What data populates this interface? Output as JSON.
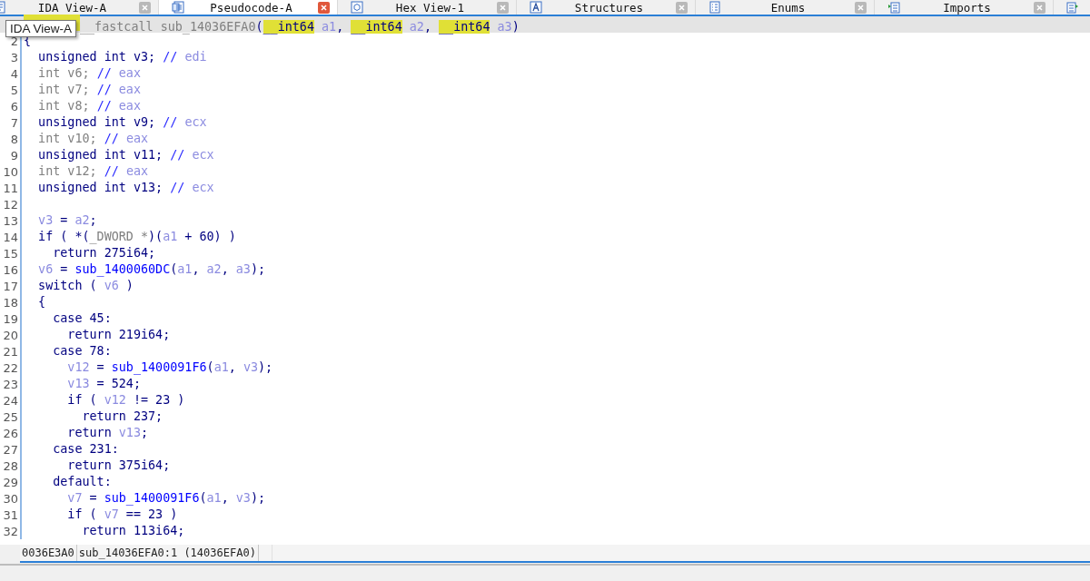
{
  "tabs": [
    {
      "label": "IDA View-A",
      "selected": false,
      "kind": "disasm"
    },
    {
      "label": "Pseudocode-A",
      "selected": true,
      "kind": "pseudocode"
    },
    {
      "label": "Hex View-1",
      "selected": false,
      "kind": "hex"
    },
    {
      "label": "Structures",
      "selected": false,
      "kind": "struct"
    },
    {
      "label": "Enums",
      "selected": false,
      "kind": "enum"
    },
    {
      "label": "Imports",
      "selected": false,
      "kind": "imports"
    },
    {
      "selected": false,
      "kind": "exports"
    }
  ],
  "tooltip": "IDA View-A",
  "code": {
    "lines": [
      {
        "tokens": [
          {
            "kind": "hl"
          },
          {
            "kind": "dim",
            "text": "__fastcall sub_14036EFA0"
          },
          {
            "kind": "plain",
            "text": "("
          },
          {
            "kind": "hl",
            "text": "__int64"
          },
          {
            "kind": "var",
            "text": " a1"
          },
          {
            "kind": "plain",
            "text": ", "
          },
          {
            "kind": "hl",
            "text": "__int64"
          },
          {
            "kind": "var",
            "text": " a2"
          },
          {
            "kind": "plain",
            "text": ", "
          },
          {
            "kind": "hl",
            "text": "__int64"
          },
          {
            "kind": "var",
            "text": " a3"
          },
          {
            "kind": "plain",
            "text": ")"
          }
        ]
      },
      {
        "number": "2",
        "tokens": [
          {
            "kind": "plain",
            "text": "{"
          }
        ]
      },
      {
        "number": "3",
        "tokens": [
          {
            "kind": "plain",
            "text": "  unsigned int v3; "
          },
          {
            "kind": "comment",
            "text": "// "
          },
          {
            "kind": "var",
            "text": "edi"
          }
        ]
      },
      {
        "number": "4",
        "tokens": [
          {
            "kind": "dim",
            "text": "  int v6; "
          },
          {
            "kind": "comment",
            "text": "// "
          },
          {
            "kind": "var",
            "text": "eax"
          }
        ]
      },
      {
        "number": "5",
        "tokens": [
          {
            "kind": "dim",
            "text": "  int v7; "
          },
          {
            "kind": "comment",
            "text": "// "
          },
          {
            "kind": "var",
            "text": "eax"
          }
        ]
      },
      {
        "number": "6",
        "tokens": [
          {
            "kind": "dim",
            "text": "  int v8; "
          },
          {
            "kind": "comment",
            "text": "// "
          },
          {
            "kind": "var",
            "text": "eax"
          }
        ]
      },
      {
        "number": "7",
        "tokens": [
          {
            "kind": "plain",
            "text": "  unsigned int v9; "
          },
          {
            "kind": "comment",
            "text": "// "
          },
          {
            "kind": "var",
            "text": "ecx"
          }
        ]
      },
      {
        "number": "8",
        "tokens": [
          {
            "kind": "dim",
            "text": "  int v10; "
          },
          {
            "kind": "comment",
            "text": "// "
          },
          {
            "kind": "var",
            "text": "eax"
          }
        ]
      },
      {
        "number": "9",
        "tokens": [
          {
            "kind": "plain",
            "text": "  unsigned int v11; "
          },
          {
            "kind": "comment",
            "text": "// "
          },
          {
            "kind": "var",
            "text": "ecx"
          }
        ]
      },
      {
        "number": "10",
        "tokens": [
          {
            "kind": "dim",
            "text": "  int v12; "
          },
          {
            "kind": "comment",
            "text": "// "
          },
          {
            "kind": "var",
            "text": "eax"
          }
        ]
      },
      {
        "number": "11",
        "tokens": [
          {
            "kind": "plain",
            "text": "  unsigned int v13; "
          },
          {
            "kind": "comment",
            "text": "// "
          },
          {
            "kind": "var",
            "text": "ecx"
          }
        ]
      },
      {
        "number": "12"
      },
      {
        "number": "13",
        "tokens": [
          {
            "kind": "var",
            "text": "  v3"
          },
          {
            "kind": "plain",
            "text": " = "
          },
          {
            "kind": "var",
            "text": "a2"
          },
          {
            "kind": "plain",
            "text": ";"
          }
        ]
      },
      {
        "number": "14",
        "tokens": [
          {
            "kind": "plain",
            "text": "  if ( *("
          },
          {
            "kind": "dim",
            "text": "_DWORD *"
          },
          {
            "kind": "plain",
            "text": ")("
          },
          {
            "kind": "var",
            "text": "a1"
          },
          {
            "kind": "plain",
            "text": " + 60) )"
          }
        ]
      },
      {
        "number": "15",
        "tokens": [
          {
            "kind": "plain",
            "text": "    return 275i64;"
          }
        ]
      },
      {
        "number": "16",
        "tokens": [
          {
            "kind": "var",
            "text": "  v6"
          },
          {
            "kind": "plain",
            "text": " = "
          },
          {
            "kind": "func",
            "text": "sub_1400060DC"
          },
          {
            "kind": "plain",
            "text": "("
          },
          {
            "kind": "var",
            "text": "a1"
          },
          {
            "kind": "plain",
            "text": ", "
          },
          {
            "kind": "var",
            "text": "a2"
          },
          {
            "kind": "plain",
            "text": ", "
          },
          {
            "kind": "var",
            "text": "a3"
          },
          {
            "kind": "plain",
            "text": ");"
          }
        ]
      },
      {
        "number": "17",
        "tokens": [
          {
            "kind": "plain",
            "text": "  switch ( "
          },
          {
            "kind": "var",
            "text": "v6"
          },
          {
            "kind": "plain",
            "text": " )"
          }
        ]
      },
      {
        "number": "18",
        "tokens": [
          {
            "kind": "plain",
            "text": "  {"
          }
        ]
      },
      {
        "number": "19",
        "tokens": [
          {
            "kind": "plain",
            "text": "    case 45:"
          }
        ]
      },
      {
        "number": "20",
        "tokens": [
          {
            "kind": "plain",
            "text": "      return 219i64;"
          }
        ]
      },
      {
        "number": "21",
        "tokens": [
          {
            "kind": "plain",
            "text": "    case 78:"
          }
        ]
      },
      {
        "number": "22",
        "tokens": [
          {
            "kind": "var",
            "text": "      v12"
          },
          {
            "kind": "plain",
            "text": " = "
          },
          {
            "kind": "func",
            "text": "sub_1400091F6"
          },
          {
            "kind": "plain",
            "text": "("
          },
          {
            "kind": "var",
            "text": "a1"
          },
          {
            "kind": "plain",
            "text": ", "
          },
          {
            "kind": "var",
            "text": "v3"
          },
          {
            "kind": "plain",
            "text": ");"
          }
        ]
      },
      {
        "number": "23",
        "tokens": [
          {
            "kind": "var",
            "text": "      v13"
          },
          {
            "kind": "plain",
            "text": " = 524;"
          }
        ]
      },
      {
        "number": "24",
        "tokens": [
          {
            "kind": "plain",
            "text": "      if ( "
          },
          {
            "kind": "var",
            "text": "v12"
          },
          {
            "kind": "plain",
            "text": " != 23 )"
          }
        ]
      },
      {
        "number": "25",
        "tokens": [
          {
            "kind": "plain",
            "text": "        return 237;"
          }
        ]
      },
      {
        "number": "26",
        "tokens": [
          {
            "kind": "plain",
            "text": "      return "
          },
          {
            "kind": "var",
            "text": "v13"
          },
          {
            "kind": "plain",
            "text": ";"
          }
        ]
      },
      {
        "number": "27",
        "tokens": [
          {
            "kind": "plain",
            "text": "    case 231:"
          }
        ]
      },
      {
        "number": "28",
        "tokens": [
          {
            "kind": "plain",
            "text": "      return 375i64;"
          }
        ]
      },
      {
        "number": "29",
        "tokens": [
          {
            "kind": "plain",
            "text": "    default:"
          }
        ]
      },
      {
        "number": "30",
        "tokens": [
          {
            "kind": "var",
            "text": "      v7"
          },
          {
            "kind": "plain",
            "text": " = "
          },
          {
            "kind": "func",
            "text": "sub_1400091F6"
          },
          {
            "kind": "plain",
            "text": "("
          },
          {
            "kind": "var",
            "text": "a1"
          },
          {
            "kind": "plain",
            "text": ", "
          },
          {
            "kind": "var",
            "text": "v3"
          },
          {
            "kind": "plain",
            "text": ");"
          }
        ]
      },
      {
        "number": "31",
        "tokens": [
          {
            "kind": "plain",
            "text": "      if ( "
          },
          {
            "kind": "var",
            "text": "v7"
          },
          {
            "kind": "plain",
            "text": " == 23 )"
          }
        ]
      },
      {
        "number": "32",
        "tokens": [
          {
            "kind": "plain",
            "text": "        return 113i64;"
          }
        ]
      }
    ]
  },
  "status_bar": {
    "address": "0036E3A0",
    "location": "sub_14036EFA0:1 (14036EFA0)"
  }
}
